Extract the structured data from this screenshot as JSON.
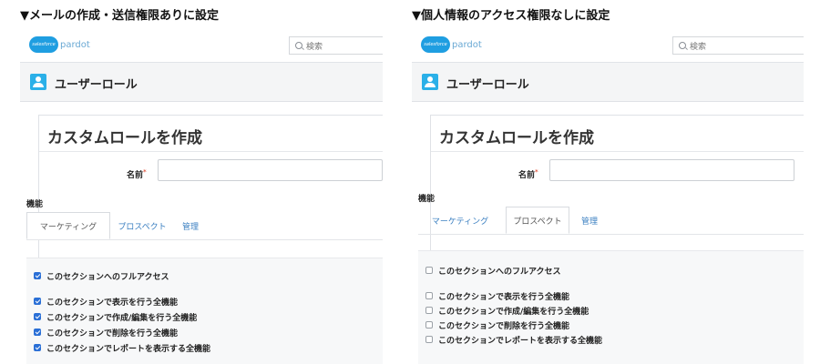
{
  "panels": [
    {
      "caption": "▼メールの作成・送信権限ありに設定",
      "logo_small": "salesforce",
      "logo_text": "pardot",
      "search_placeholder": "検索",
      "header_title": "ユーザーロール",
      "card_title": "カスタムロールを作成",
      "name_label": "名前",
      "name_required": "*",
      "name_value": "",
      "section_label": "機能",
      "tabs": [
        {
          "label": "マーケティング",
          "active": true
        },
        {
          "label": "プロスペクト",
          "active": false
        },
        {
          "label": "管理",
          "active": false
        }
      ],
      "permissions": [
        {
          "label": "このセクションへのフルアクセス",
          "checked": true
        },
        {
          "label": "このセクションで表示を行う全機能",
          "checked": true
        },
        {
          "label": "このセクションで作成/編集を行う全機能",
          "checked": true
        },
        {
          "label": "このセクションで削除を行う全機能",
          "checked": true
        },
        {
          "label": "このセクションでレポートを表示する全機能",
          "checked": true
        }
      ]
    },
    {
      "caption": "▼個人情報のアクセス権限なしに設定",
      "logo_small": "salesforce",
      "logo_text": "pardot",
      "search_placeholder": "検索",
      "header_title": "ユーザーロール",
      "card_title": "カスタムロールを作成",
      "name_label": "名前",
      "name_required": "*",
      "name_value": "",
      "section_label": "機能",
      "tabs": [
        {
          "label": "マーケティング",
          "active": false
        },
        {
          "label": "プロスペクト",
          "active": true
        },
        {
          "label": "管理",
          "active": false
        }
      ],
      "permissions": [
        {
          "label": "このセクションへのフルアクセス",
          "checked": false
        },
        {
          "label": "このセクションで表示を行う全機能",
          "checked": false
        },
        {
          "label": "このセクションで作成/編集を行う全機能",
          "checked": false
        },
        {
          "label": "このセクションで削除を行う全機能",
          "checked": false
        },
        {
          "label": "このセクションでレポートを表示する全機能",
          "checked": false
        }
      ]
    }
  ],
  "colors": {
    "salesforce_blue": "#1f9ee1",
    "link_blue": "#3a7fc1",
    "checkbox_blue": "#2a6fd6",
    "required_red": "#e25b45"
  }
}
